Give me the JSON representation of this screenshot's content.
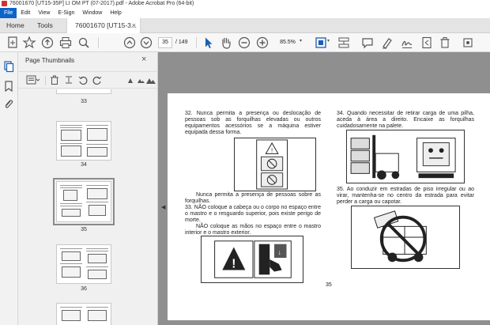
{
  "window": {
    "title": "76001670 [UT15-35P] LI OM PT (07-2017).pdf - Adobe Acrobat Pro (64-bit)"
  },
  "menu": [
    "File",
    "Edit",
    "View",
    "E-Sign",
    "Window",
    "Help"
  ],
  "tabs": {
    "home": "Home",
    "tools": "Tools",
    "document": "76001670 [UT15-3...",
    "close_symbol": "×"
  },
  "toolbar": {
    "current_page": "35",
    "page_total": "/ 149",
    "zoom": "85.5%",
    "icons": [
      "create-pdf-icon",
      "bookmark-icon",
      "upload-icon",
      "print-icon",
      "search-icon",
      "prev-page-icon",
      "next-page-icon",
      "select-cursor-icon",
      "hand-icon",
      "zoom-out-icon",
      "zoom-in-icon",
      "fit-page-icon",
      "scroll-icon",
      "comment-icon",
      "highlight-icon",
      "sign-icon",
      "delete-icon",
      "more-icon"
    ]
  },
  "panel": {
    "title": "Page Thumbnails",
    "close": "×",
    "tools": [
      "options-menu-icon",
      "trash-icon",
      "rotate-ccw-icon",
      "rotate-cw-icon",
      "insert-icon",
      "small-view-icon",
      "large-view-icon"
    ]
  },
  "thumbnails": [
    {
      "label": "33"
    },
    {
      "label": "34"
    },
    {
      "label": "35",
      "selected": true
    },
    {
      "label": "36"
    }
  ],
  "document": {
    "left_col": {
      "p32": "32. Nunca permita a presença ou deslocação de pessoas sob as forquilhas elevadas ou outros equipamentos acessórios se a máquina estiver equipada dessa forma.",
      "p32b": "Nunca permita a presença de pessoas sobre as forquilhas.",
      "p33": "33. NÃO coloque a cabeça ou o corpo no espaço entre o mastro e o resguardo superior, pois existe perigo de morte.",
      "p33b": "NÃO coloque as mãos no espaço entre o mastro interior e o mastro exterior."
    },
    "right_col": {
      "p34": "34. Quando necessitar de retirar carga de uma pilha, aceda à área a direito. Encaixe as forquilhas cuidadosamente na palete.",
      "p35": "35. Ao conduzir em estradas de piso irregular ou ao virar, mantenha-se no centro da estrada para evitar perder a carga ou capotar."
    },
    "page_number": "35"
  }
}
